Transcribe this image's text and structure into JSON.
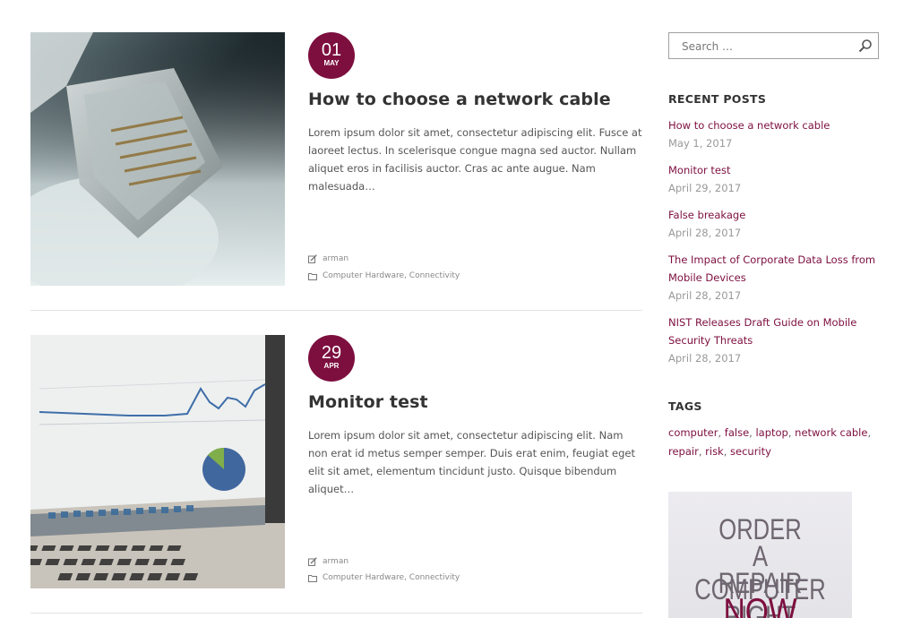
{
  "posts": [
    {
      "day": "01",
      "month": "MAY",
      "title": "How to choose a network cable",
      "excerpt": "Lorem ipsum dolor sit amet, consectetur adipiscing elit. Fusce at laoreet lectus. In scelerisque congue magna sed auctor. Nullam aliquet eros in facilisis auctor. Cras ac ante augue. Nam malesuada…",
      "author": "arman",
      "categories": [
        "Computer Hardware",
        "Connectivity"
      ]
    },
    {
      "day": "29",
      "month": "APR",
      "title": "Monitor test",
      "excerpt": "Lorem ipsum dolor sit amet, consectetur adipiscing elit. Nam non erat id metus semper semper. Duis erat enim, feugiat eget elit sit amet, elementum tincidunt justo. Quisque bibendum aliquet…",
      "author": "arman",
      "categories": [
        "Computer Hardware",
        "Connectivity"
      ]
    }
  ],
  "search": {
    "placeholder": "Search …"
  },
  "recent_posts": {
    "heading": "RECENT POSTS",
    "items": [
      {
        "title": "How to choose a network cable",
        "date": "May 1, 2017"
      },
      {
        "title": "Monitor test",
        "date": "April 29, 2017"
      },
      {
        "title": "False breakage",
        "date": "April 28, 2017"
      },
      {
        "title": "The Impact of Corporate Data Loss from Mobile Devices",
        "date": "April 28, 2017"
      },
      {
        "title": "NIST Releases Draft Guide on Mobile Security Threats",
        "date": "April 28, 2017"
      }
    ]
  },
  "tags": {
    "heading": "TAGS",
    "items": [
      "computer",
      "false",
      "laptop",
      "network cable",
      "repair",
      "risk",
      "security"
    ]
  },
  "banner": {
    "line1": "ORDER",
    "line2": "A COMPUTER",
    "line3": "REPAIR RIGHT",
    "line4": "NOW"
  },
  "colors": {
    "accent": "#7d0f3f",
    "text": "#555555",
    "muted": "#999999"
  },
  "icons": {
    "author": "edit-icon",
    "category": "folder-icon",
    "search": "search-icon"
  }
}
